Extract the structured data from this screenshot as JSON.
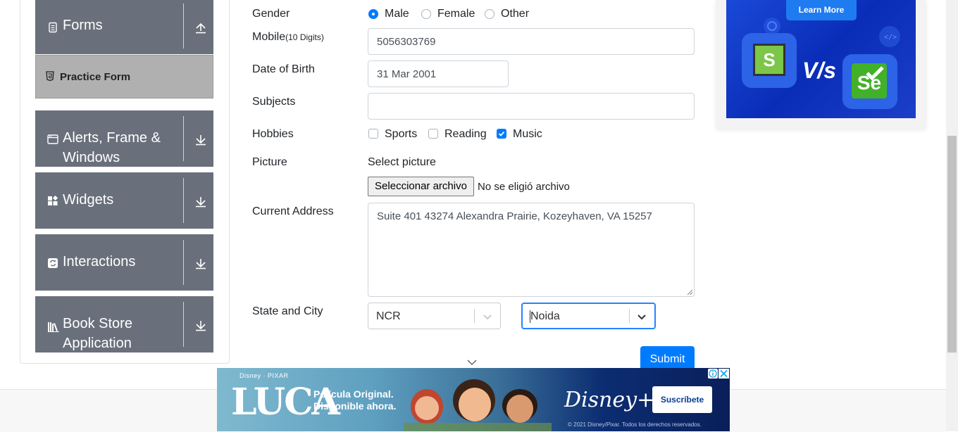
{
  "sidebar": {
    "groups": [
      {
        "label": "Forms",
        "icon": "form-icon",
        "arrow": "arrow-up-icon"
      },
      {
        "label_line1": "Alerts, Frame &",
        "label_line2": "Windows",
        "icon": "window-icon",
        "arrow": "arrow-down-icon"
      },
      {
        "label": "Widgets",
        "icon": "widgets-icon",
        "arrow": "arrow-down-icon"
      },
      {
        "label": "Interactions",
        "icon": "interactions-icon",
        "arrow": "arrow-down-icon"
      },
      {
        "label_line1": "Book Store",
        "label_line2": "Application",
        "icon": "books-icon",
        "arrow": "arrow-down-icon"
      }
    ],
    "active_item": {
      "label": "Practice Form",
      "icon": "html5-icon"
    }
  },
  "form": {
    "gender": {
      "label": "Gender",
      "options": [
        "Male",
        "Female",
        "Other"
      ],
      "selected": "Male"
    },
    "mobile": {
      "label": "Mobile",
      "hint": "(10 Digits)",
      "value": "5056303769"
    },
    "dob": {
      "label": "Date of Birth",
      "value": "31 Mar 2001"
    },
    "subjects": {
      "label": "Subjects",
      "value": ""
    },
    "hobbies": {
      "label": "Hobbies",
      "options": [
        "Sports",
        "Reading",
        "Music"
      ],
      "checked": [
        "Music"
      ]
    },
    "picture": {
      "label": "Picture",
      "caption": "Select picture",
      "button": "Seleccionar archivo",
      "status": "No se eligió archivo"
    },
    "address": {
      "label": "Current Address",
      "value": "Suite 401 43274 Alexandra Prairie, Kozeyhaven, VA 15257"
    },
    "state_city": {
      "label": "State and City",
      "state": "NCR",
      "city": "Noida"
    },
    "submit": "Submit"
  },
  "right_ad": {
    "button": "Learn More",
    "vs_text": "V/s",
    "left_logo": "S",
    "right_logo": "Se"
  },
  "bottom_ad": {
    "brand": "Disney · PIXAR",
    "movie": "LUCA",
    "line1": "Película Original.",
    "line2": "Disponible ahora.",
    "service": "Disney+",
    "cta": "Suscríbete",
    "copyright": "© 2021 Disney/Pixar. Todos los derechos reservados."
  },
  "colors": {
    "primary": "#007bff",
    "sidebar_group": "#69707b",
    "sidebar_active": "#b0b0b0"
  }
}
